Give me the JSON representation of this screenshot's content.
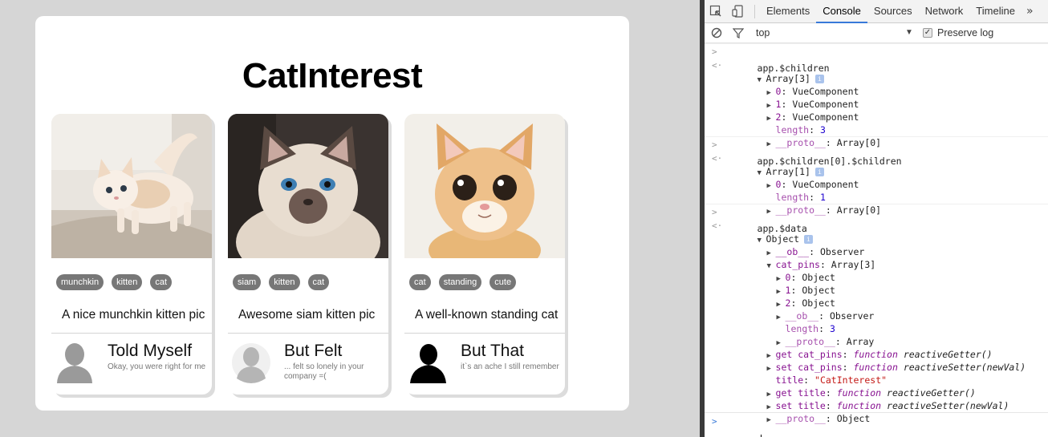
{
  "app": {
    "title": "CatInterest",
    "pins": [
      {
        "tags": [
          "munchkin",
          "kitten",
          "cat"
        ],
        "caption": "A nice munchkin kitten pic",
        "author": "Told Myself",
        "quote": "Okay, you were right for me"
      },
      {
        "tags": [
          "siam",
          "kitten",
          "cat"
        ],
        "caption": "Awesome siam kitten pic",
        "author": "But Felt",
        "quote": "... felt so lonely in your company =("
      },
      {
        "tags": [
          "cat",
          "standing",
          "cute"
        ],
        "caption": "A well-known standing cat",
        "author": "But That",
        "quote": "it`s an ache I still remember"
      }
    ]
  },
  "devtools": {
    "tabs": [
      "Elements",
      "Console",
      "Sources",
      "Network",
      "Timeline"
    ],
    "more": "»",
    "context": "top",
    "preserve_log": "Preserve log",
    "console": {
      "cmd1": "app.$children",
      "arr3": "Array[3]",
      "c0": "0",
      "c1": "1",
      "c2": "2",
      "vue": "VueComponent",
      "length_key": "length",
      "len3": "3",
      "proto_key": "__proto__",
      "array0": "Array[0]",
      "cmd2": "app.$children[0].$children",
      "arr1": "Array[1]",
      "len1": "1",
      "cmd3": "app.$data",
      "object": "Object",
      "ob_key": "__ob__",
      "observer": "Observer",
      "catpins_key": "cat_pins",
      "array_word": "Array",
      "get_catpins": "get cat_pins",
      "set_catpins": "set cat_pins",
      "function_kw": "function",
      "getter": "reactiveGetter()",
      "setter": "reactiveSetter(newVal)",
      "title_key": "title",
      "title_val": "\"CatInterest\"",
      "get_title": "get title",
      "set_title": "set title",
      "info": "i"
    }
  },
  "colors": {
    "accent": "#3879d9",
    "tag_bg": "#777777",
    "key_purple": "#881391",
    "number_blue": "#1c00cf",
    "string_red": "#c41a16"
  }
}
